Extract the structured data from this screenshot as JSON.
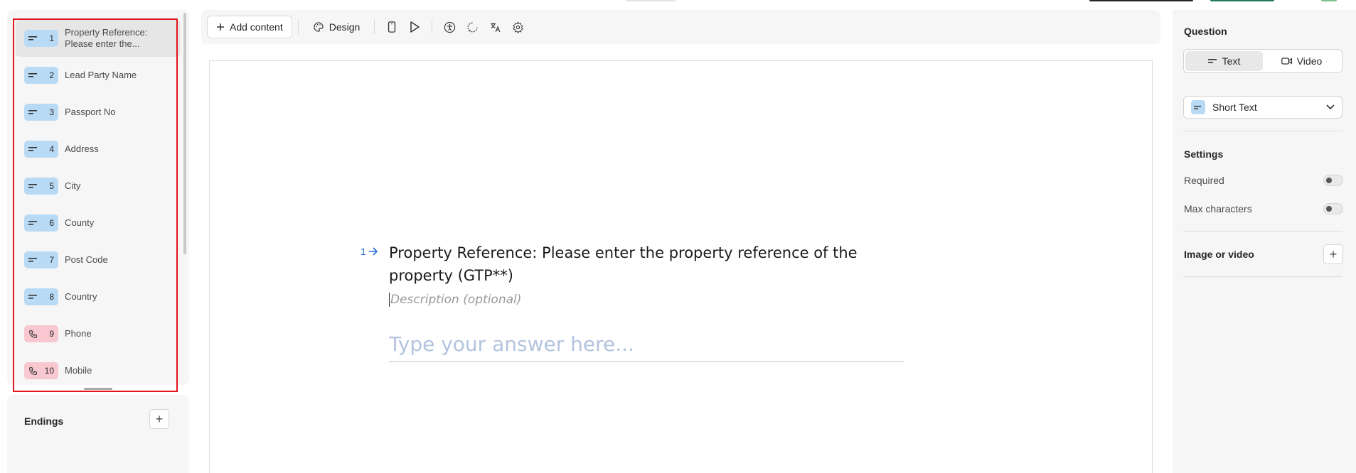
{
  "sidebar": {
    "questions": [
      {
        "number": "1",
        "label": "Property Reference: Please enter the...",
        "type": "text"
      },
      {
        "number": "2",
        "label": "Lead Party Name",
        "type": "text"
      },
      {
        "number": "3",
        "label": "Passport No",
        "type": "text"
      },
      {
        "number": "4",
        "label": "Address",
        "type": "text"
      },
      {
        "number": "5",
        "label": "City",
        "type": "text"
      },
      {
        "number": "6",
        "label": "County",
        "type": "text"
      },
      {
        "number": "7",
        "label": "Post Code",
        "type": "text"
      },
      {
        "number": "8",
        "label": "Country",
        "type": "text"
      },
      {
        "number": "9",
        "label": "Phone",
        "type": "phone"
      },
      {
        "number": "10",
        "label": "Mobile",
        "type": "phone"
      }
    ],
    "endings_title": "Endings",
    "endings_add": "+"
  },
  "toolbar": {
    "add_content_label": "Add content",
    "design_label": "Design"
  },
  "question": {
    "number": "1",
    "title": "Property Reference: Please enter the property reference of the property (GTP**)",
    "description_placeholder": "Description (optional)",
    "answer_placeholder": "Type your answer here..."
  },
  "right_panel": {
    "section_title": "Question",
    "tabs": [
      "Text",
      "Video"
    ],
    "selected_tab": "Text",
    "question_type": "Short Text",
    "settings_title": "Settings",
    "settings": [
      {
        "label": "Required"
      },
      {
        "label": "Max characters"
      }
    ],
    "media_label": "Image or video",
    "media_add": "+"
  },
  "colors": {
    "text_badge": "#b9daf5",
    "phone_badge": "#f8c7cf",
    "accent": "#1f6fd6",
    "highlight": "#e0141a"
  }
}
